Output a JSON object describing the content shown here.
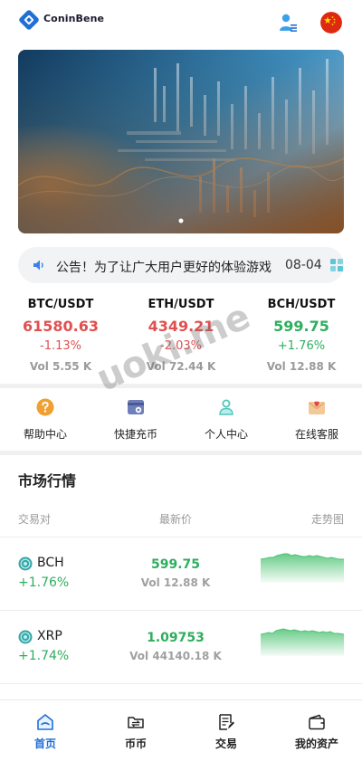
{
  "app": {
    "brand": "ConinBene"
  },
  "notice": {
    "text": "公告！为了让广大用户更好的体验游戏",
    "date": "08-04"
  },
  "tickers": [
    {
      "pair": "BTC/USDT",
      "price": "61580.63",
      "change": "-1.13%",
      "vol": "Vol 5.55 K",
      "trend": "down"
    },
    {
      "pair": "ETH/USDT",
      "price": "4349.21",
      "change": "-2.03%",
      "vol": "Vol 72.44 K",
      "trend": "down"
    },
    {
      "pair": "BCH/USDT",
      "price": "599.75",
      "change": "+1.76%",
      "vol": "Vol 12.88 K",
      "trend": "up"
    }
  ],
  "quick_menu": [
    {
      "label": "帮助中心",
      "icon": "help-icon"
    },
    {
      "label": "快捷充币",
      "icon": "deposit-icon"
    },
    {
      "label": "个人中心",
      "icon": "profile-icon"
    },
    {
      "label": "在线客服",
      "icon": "support-icon"
    }
  ],
  "market": {
    "title": "市场行情",
    "headers": {
      "pair": "交易对",
      "last": "最新价",
      "trend": "走势图"
    },
    "rows": [
      {
        "symbol": "BCH",
        "change": "+1.76%",
        "price": "599.75",
        "vol": "Vol 12.88 K"
      },
      {
        "symbol": "XRP",
        "change": "+1.74%",
        "price": "1.09753",
        "vol": "Vol 44140.18 K"
      }
    ]
  },
  "watermark": "uoki.me",
  "bottom_nav": [
    {
      "label": "首页",
      "icon": "home-icon",
      "active": true
    },
    {
      "label": "币币",
      "icon": "coin-swap-icon",
      "active": false
    },
    {
      "label": "交易",
      "icon": "trade-icon",
      "active": false
    },
    {
      "label": "我的资产",
      "icon": "wallet-icon",
      "active": false
    }
  ],
  "colors": {
    "accent": "#1f6fd6",
    "down": "#e05050",
    "up": "#2eae5e",
    "muted": "#9a9a9a"
  }
}
